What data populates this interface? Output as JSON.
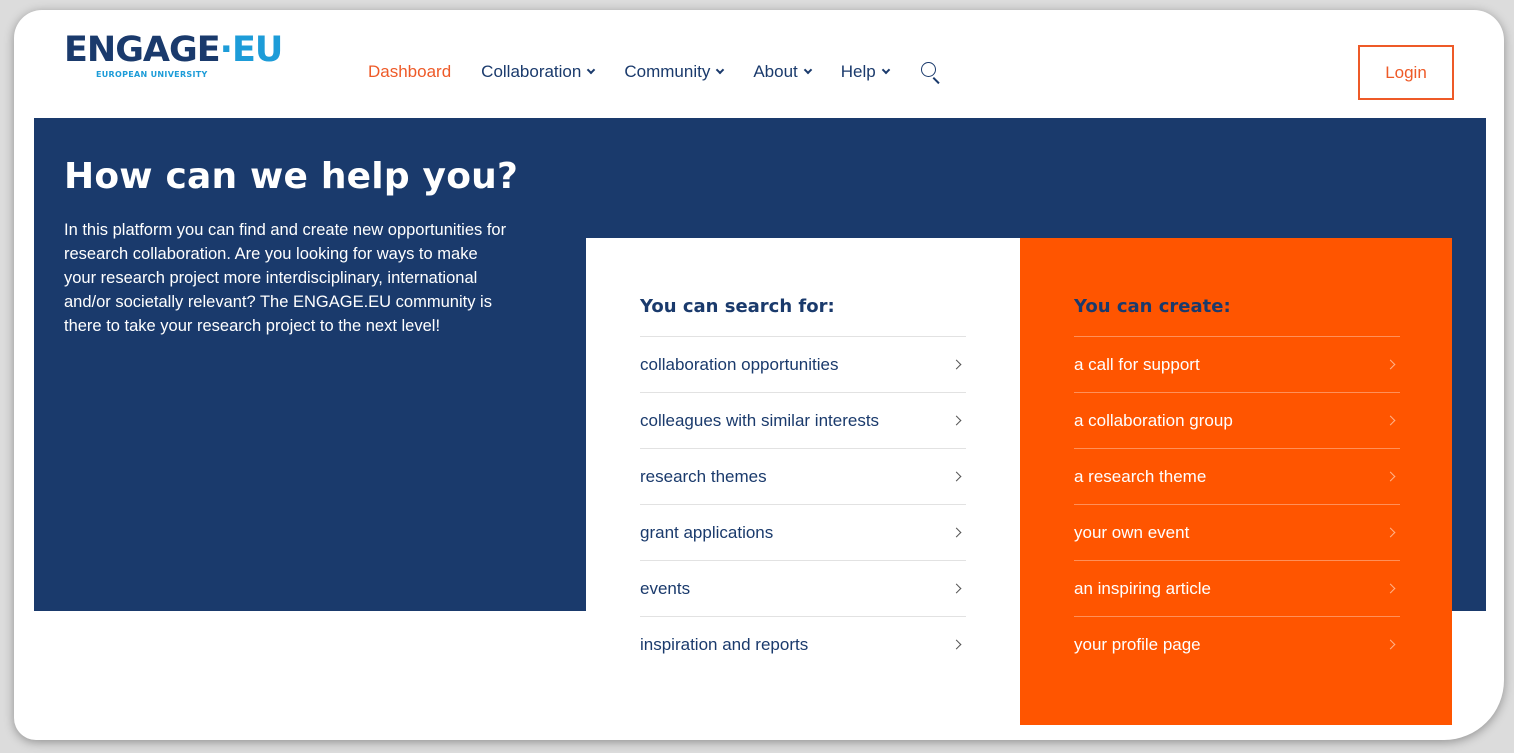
{
  "header": {
    "logo_prefix": "ENGAGE",
    "logo_dot": "·",
    "logo_suffix": "EU",
    "logo_sub": "EUROPEAN UNIVERSITY",
    "nav": [
      {
        "label": "Dashboard",
        "active": true
      },
      {
        "label": "Collaboration",
        "dropdown": true
      },
      {
        "label": "Community",
        "dropdown": true
      },
      {
        "label": "About",
        "dropdown": true
      },
      {
        "label": "Help",
        "dropdown": true
      }
    ],
    "search_icon": "search-icon",
    "login_label": "Login"
  },
  "hero": {
    "title": "How can we help you?",
    "text": "In this platform you can find and create new opportunities for research collaboration. Are you looking for ways to make your research project more interdisciplinary, international and/or societally relevant? The ENGAGE.EU community is there to take your research project to the next level!"
  },
  "search_card": {
    "title": "You can search for:",
    "items": [
      "collaboration opportunities",
      "colleagues with similar interests",
      "research themes",
      "grant applications",
      "events",
      "inspiration and reports"
    ]
  },
  "create_card": {
    "title": "You can create:",
    "items": [
      "a call for support",
      "a collaboration group",
      "a research theme",
      "your own event",
      "an inspiring article",
      "your profile page"
    ]
  },
  "colors": {
    "navy": "#1a3a6c",
    "orange": "#ff5500",
    "accent": "#ee5a28",
    "logo_blue": "#1d9cd8"
  }
}
